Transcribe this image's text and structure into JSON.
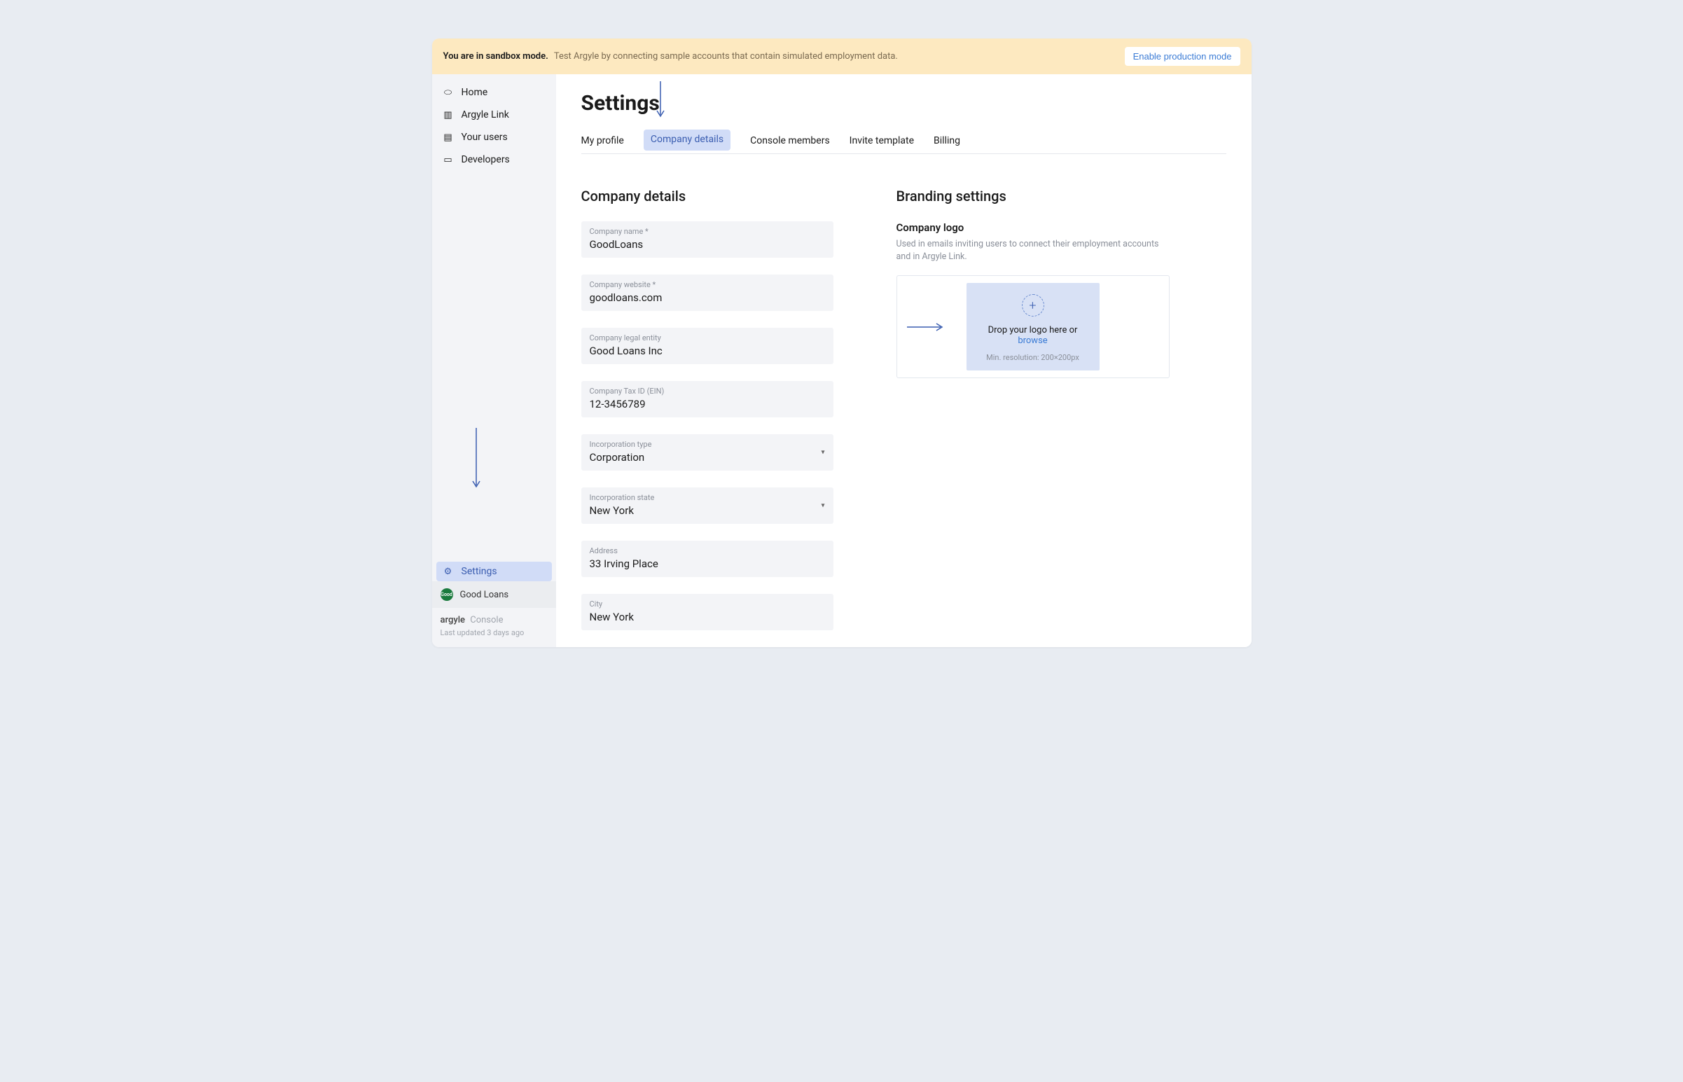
{
  "banner": {
    "strong": "You are in sandbox mode.",
    "text": "Test Argyle by connecting sample accounts that contain simulated employment data.",
    "button": "Enable production mode"
  },
  "sidebar": {
    "items": [
      {
        "label": "Home",
        "icon": "⌂"
      },
      {
        "label": "Argyle Link",
        "icon": "▭"
      },
      {
        "label": "Your users",
        "icon": "▤"
      },
      {
        "label": "Developers",
        "icon": "▣"
      }
    ],
    "settings_label": "Settings",
    "company": "Good Loans",
    "brand1": "argyle",
    "brand2": "Console",
    "updated": "Last updated 3 days ago"
  },
  "page": {
    "title": "Settings",
    "tabs": [
      "My profile",
      "Company details",
      "Console members",
      "Invite template",
      "Billing"
    ]
  },
  "company_details": {
    "title": "Company details",
    "fields": [
      {
        "label": "Company name *",
        "value": "GoodLoans",
        "type": "text"
      },
      {
        "label": "Company website *",
        "value": "goodloans.com",
        "type": "text"
      },
      {
        "label": "Company legal entity",
        "value": "Good Loans Inc",
        "type": "text"
      },
      {
        "label": "Company Tax ID (EIN)",
        "value": "12-3456789",
        "type": "text"
      },
      {
        "label": "Incorporation type",
        "value": "Corporation",
        "type": "select"
      },
      {
        "label": "Incorporation state",
        "value": "New York",
        "type": "select"
      },
      {
        "label": "Address",
        "value": "33 Irving Place",
        "type": "text"
      },
      {
        "label": "City",
        "value": "New York",
        "type": "text"
      }
    ]
  },
  "branding": {
    "title": "Branding settings",
    "logo_label": "Company logo",
    "logo_desc": "Used in emails inviting users to connect their employment accounts and in Argyle Link.",
    "drop_text": "Drop your logo here or ",
    "browse": "browse",
    "hint": "Min. resolution: 200×200px"
  }
}
